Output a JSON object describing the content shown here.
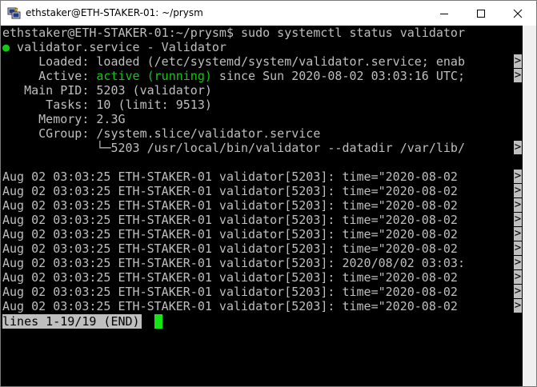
{
  "window": {
    "title": "ethstaker@ETH-STAKER-01: ~/prysm"
  },
  "icons": {
    "app": "putty-icon",
    "minimize": "minimize-icon",
    "maximize": "maximize-icon",
    "close": "close-icon"
  },
  "terminal": {
    "prompt": "ethstaker@ETH-STAKER-01:~/prysm$ sudo systemctl status validator",
    "service_bullet": "●",
    "service_header": " validator.service - Validator",
    "loaded": "     Loaded: loaded (/etc/systemd/system/validator.service; enab",
    "active_label": "     Active: ",
    "active_state": "active (running)",
    "active_since": " since Sun 2020-08-02 03:03:16 UTC;",
    "main_pid": "   Main PID: 5203 (validator)",
    "tasks": "      Tasks: 10 (limit: 9513)",
    "memory": "     Memory: 2.3G",
    "cgroup": "     CGroup: /system.slice/validator.service",
    "cgroup_child": "             └─5203 /usr/local/bin/validator --datadir /var/lib/",
    "log_lines": [
      "Aug 02 03:03:25 ETH-STAKER-01 validator[5203]: time=\"2020-08-02",
      "Aug 02 03:03:25 ETH-STAKER-01 validator[5203]: time=\"2020-08-02",
      "Aug 02 03:03:25 ETH-STAKER-01 validator[5203]: time=\"2020-08-02",
      "Aug 02 03:03:25 ETH-STAKER-01 validator[5203]: time=\"2020-08-02",
      "Aug 02 03:03:25 ETH-STAKER-01 validator[5203]: time=\"2020-08-02",
      "Aug 02 03:03:25 ETH-STAKER-01 validator[5203]: time=\"2020-08-02",
      "Aug 02 03:03:25 ETH-STAKER-01 validator[5203]: 2020/08/02 03:03:",
      "Aug 02 03:03:25 ETH-STAKER-01 validator[5203]: time=\"2020-08-02",
      "Aug 02 03:03:25 ETH-STAKER-01 validator[5203]: time=\"2020-08-02",
      "Aug 02 03:03:25 ETH-STAKER-01 validator[5203]: time=\"2020-08-02"
    ],
    "overflow_marker": ">",
    "pager_status": "lines 1-19/19 (END)"
  },
  "colors": {
    "terminal_bg": "#000000",
    "terminal_fg": "#bfbfbf",
    "active_green": "#13c813",
    "cursor_green": "#13e613"
  }
}
